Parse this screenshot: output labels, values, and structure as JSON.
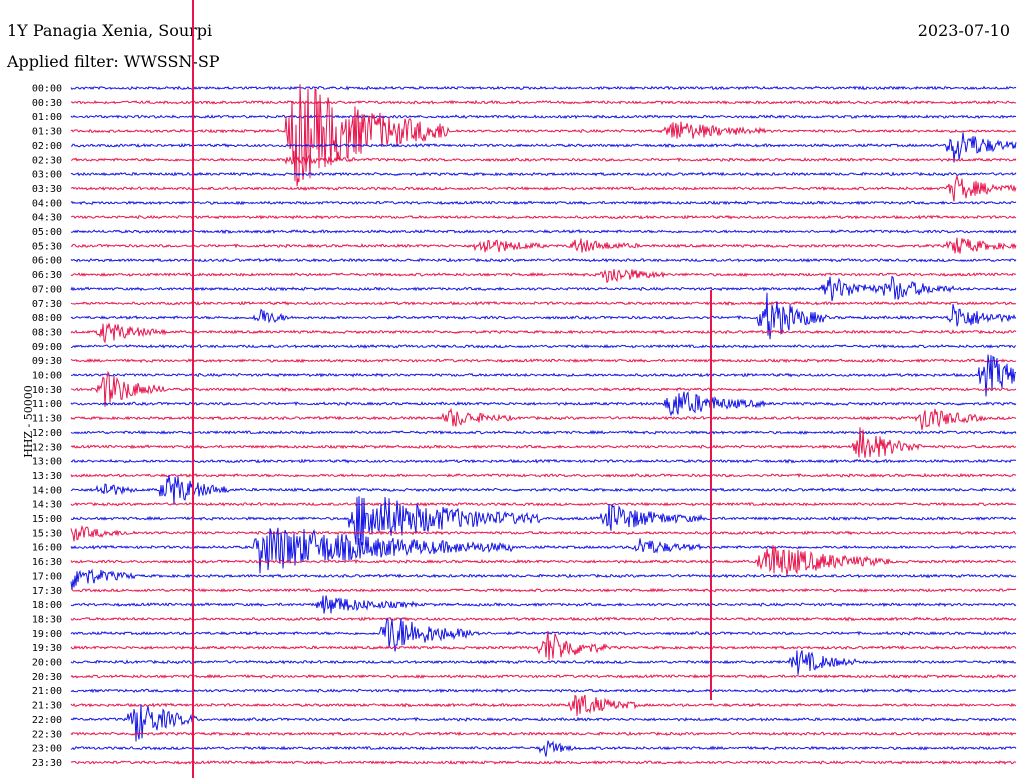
{
  "header": {
    "station": "1Y Panagia Xenia, Sourpi",
    "date": "2023-07-10",
    "filter": "Applied filter: WWSSN-SP"
  },
  "colors": {
    "odd_trace": "#1414e6",
    "even_trace": "#e8154d",
    "background": "#ffffff"
  },
  "chart_data": {
    "type": "line",
    "title": "1Y Panagia Xenia, Sourpi",
    "subtitle": "Applied filter: WWSSN-SP",
    "ylabel": "HHZ - 50000",
    "xlabel": "",
    "y_ticks": [
      "00:00",
      "00:30",
      "01:00",
      "01:30",
      "02:00",
      "02:30",
      "03:00",
      "03:30",
      "04:00",
      "04:30",
      "05:00",
      "05:30",
      "06:00",
      "06:30",
      "07:00",
      "07:30",
      "08:00",
      "08:30",
      "09:00",
      "09:30",
      "10:00",
      "10:30",
      "11:00",
      "11:30",
      "12:00",
      "12:30",
      "13:00",
      "13:30",
      "14:00",
      "14:30",
      "15:00",
      "15:30",
      "16:00",
      "16:30",
      "17:00",
      "17:30",
      "18:00",
      "18:30",
      "19:00",
      "19:30",
      "20:00",
      "20:30",
      "21:00",
      "21:30",
      "22:00",
      "22:30",
      "23:00",
      "23:30"
    ],
    "trace_minutes": 30,
    "grid": false,
    "series_colors": [
      "blue",
      "red"
    ],
    "events": [
      {
        "row": 3,
        "minute": 7,
        "amp": 60,
        "dur": 5
      },
      {
        "row": 3,
        "minute": 19,
        "amp": 12,
        "dur": 3
      },
      {
        "row": 4,
        "minute": 28,
        "amp": 20,
        "dur": 2
      },
      {
        "row": 5,
        "minute": 7,
        "amp": 8,
        "dur": 2
      },
      {
        "row": 7,
        "minute": 28,
        "amp": 14,
        "dur": 2
      },
      {
        "row": 11,
        "minute": 13,
        "amp": 10,
        "dur": 2
      },
      {
        "row": 11,
        "minute": 16,
        "amp": 8,
        "dur": 2
      },
      {
        "row": 11,
        "minute": 28,
        "amp": 10,
        "dur": 2
      },
      {
        "row": 13,
        "minute": 17,
        "amp": 10,
        "dur": 2
      },
      {
        "row": 14,
        "minute": 24,
        "amp": 14,
        "dur": 2
      },
      {
        "row": 14,
        "minute": 26,
        "amp": 14,
        "dur": 2
      },
      {
        "row": 16,
        "minute": 6,
        "amp": 10,
        "dur": 1
      },
      {
        "row": 16,
        "minute": 22,
        "amp": 28,
        "dur": 2
      },
      {
        "row": 16,
        "minute": 28,
        "amp": 14,
        "dur": 2
      },
      {
        "row": 17,
        "minute": 1,
        "amp": 12,
        "dur": 2
      },
      {
        "row": 20,
        "minute": 29,
        "amp": 24,
        "dur": 2
      },
      {
        "row": 21,
        "minute": 1,
        "amp": 20,
        "dur": 2
      },
      {
        "row": 22,
        "minute": 19,
        "amp": 16,
        "dur": 3
      },
      {
        "row": 23,
        "minute": 12,
        "amp": 10,
        "dur": 2
      },
      {
        "row": 23,
        "minute": 27,
        "amp": 14,
        "dur": 2
      },
      {
        "row": 25,
        "minute": 25,
        "amp": 20,
        "dur": 2
      },
      {
        "row": 28,
        "minute": 1,
        "amp": 10,
        "dur": 1
      },
      {
        "row": 28,
        "minute": 3,
        "amp": 20,
        "dur": 2
      },
      {
        "row": 30,
        "minute": 9,
        "amp": 30,
        "dur": 6
      },
      {
        "row": 30,
        "minute": 17,
        "amp": 16,
        "dur": 3
      },
      {
        "row": 31,
        "minute": 0,
        "amp": 8,
        "dur": 2
      },
      {
        "row": 32,
        "minute": 6,
        "amp": 26,
        "dur": 8
      },
      {
        "row": 32,
        "minute": 18,
        "amp": 10,
        "dur": 2
      },
      {
        "row": 33,
        "minute": 22,
        "amp": 20,
        "dur": 4
      },
      {
        "row": 34,
        "minute": 0,
        "amp": 14,
        "dur": 2
      },
      {
        "row": 36,
        "minute": 8,
        "amp": 10,
        "dur": 3
      },
      {
        "row": 38,
        "minute": 10,
        "amp": 22,
        "dur": 3
      },
      {
        "row": 39,
        "minute": 15,
        "amp": 20,
        "dur": 2
      },
      {
        "row": 40,
        "minute": 23,
        "amp": 14,
        "dur": 2
      },
      {
        "row": 43,
        "minute": 16,
        "amp": 14,
        "dur": 2
      },
      {
        "row": 44,
        "minute": 2,
        "amp": 24,
        "dur": 2
      },
      {
        "row": 46,
        "minute": 15,
        "amp": 10,
        "dur": 1
      }
    ]
  }
}
